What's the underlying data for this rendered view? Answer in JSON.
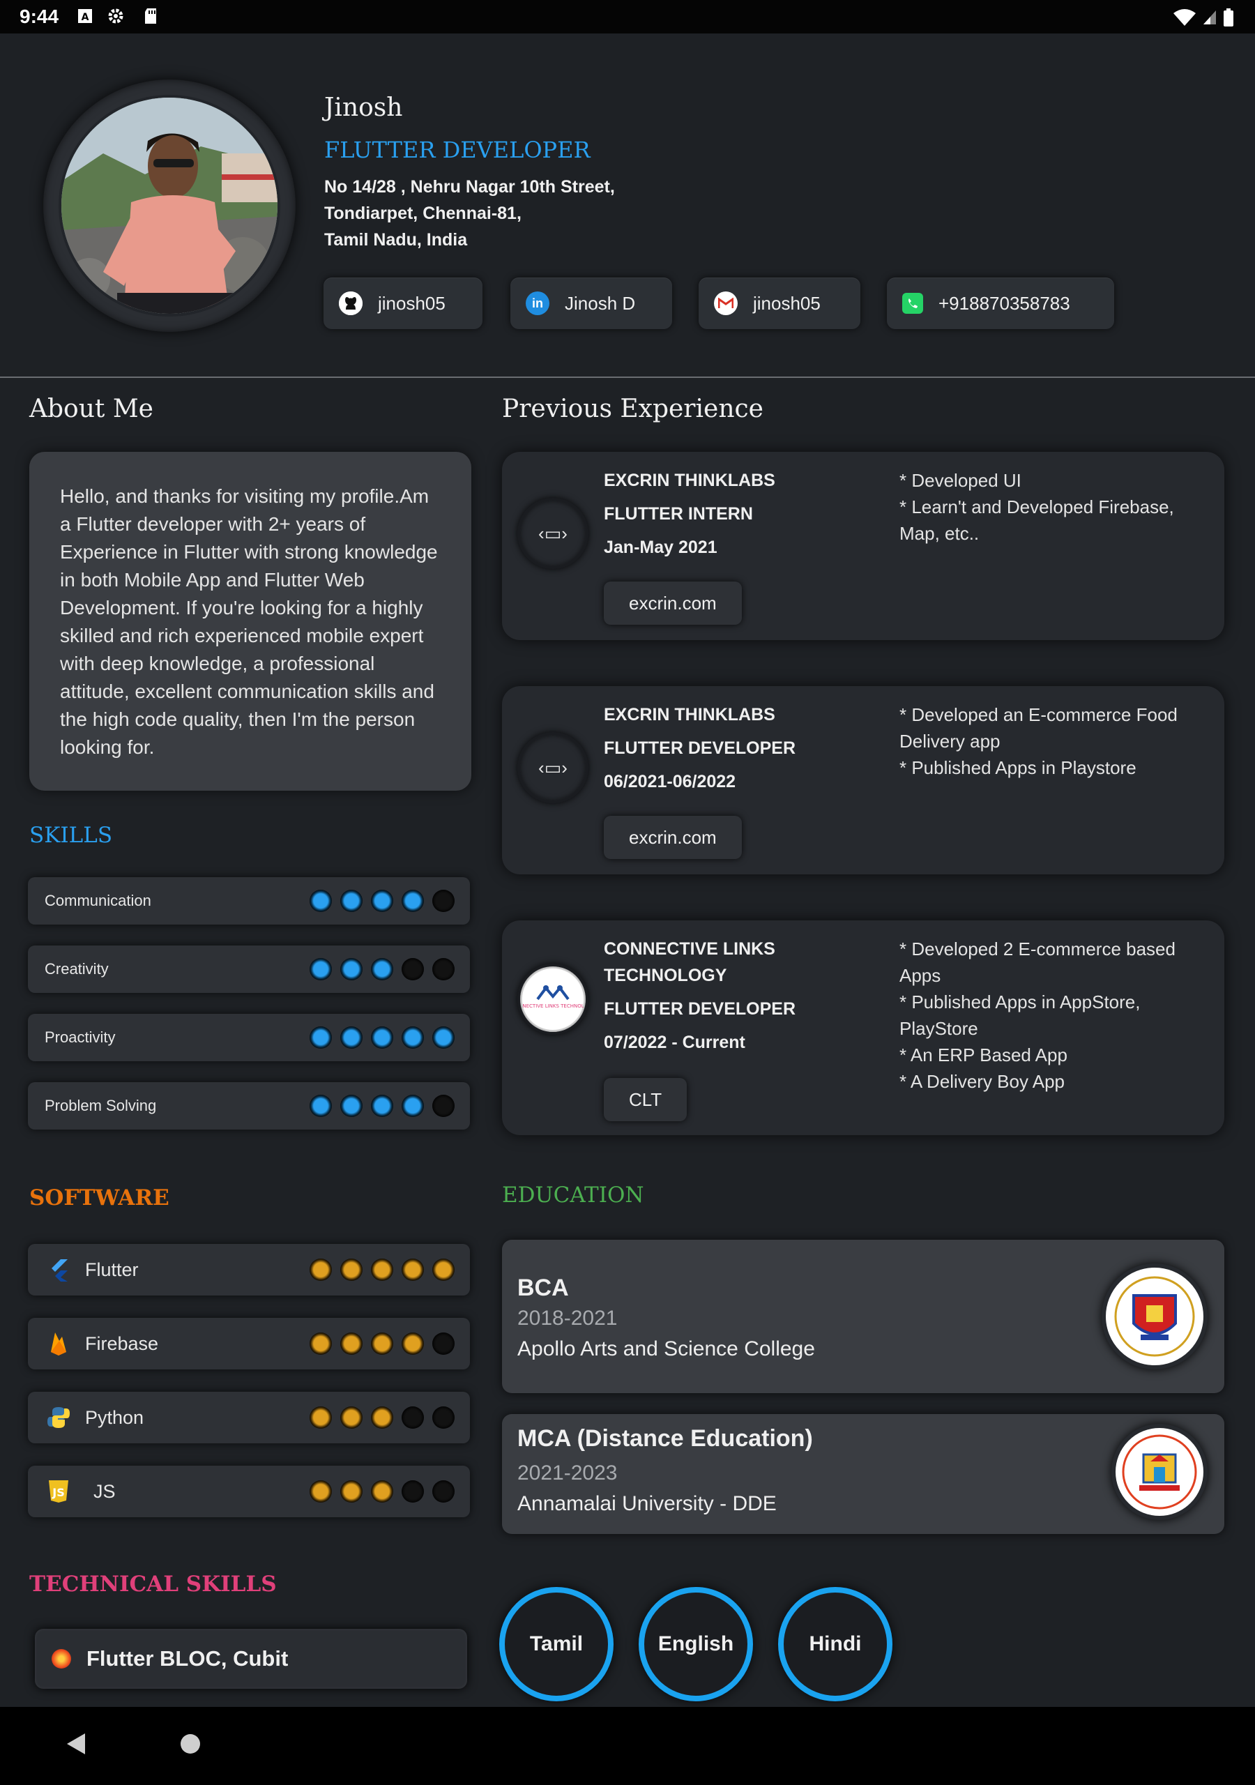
{
  "status_bar": {
    "time": "9:44",
    "icons": [
      "font-icon",
      "gear-icon",
      "sd-card-icon",
      "wifi-icon",
      "signal-icon",
      "battery-icon"
    ]
  },
  "profile": {
    "name": "Jinosh",
    "role": "FLUTTER DEVELOPER",
    "address": [
      "No 14/28 , Nehru Nagar 10th Street,",
      "Tondiarpet, Chennai-81,",
      "Tamil Nadu, India"
    ],
    "contacts": [
      {
        "icon": "github-icon",
        "label": "jinosh05"
      },
      {
        "icon": "linkedin-icon",
        "label": "Jinosh D"
      },
      {
        "icon": "gmail-icon",
        "label": "jinosh05"
      },
      {
        "icon": "whatsapp-icon",
        "label": "+918870358783"
      }
    ]
  },
  "about": {
    "title": "About Me",
    "text": "Hello, and thanks for visiting my profile.Am a Flutter developer with 2+ years of Experience in Flutter with strong knowledge in both Mobile App and Flutter Web Development. If you're looking for a highly skilled and rich experienced mobile expert with deep knowledge, a professional attitude, excellent communication skills and the high code quality, then I'm the person looking for."
  },
  "skills": {
    "title": "SKILLS",
    "items": [
      {
        "label": "Communication",
        "rating": 4,
        "max": 5
      },
      {
        "label": "Creativity",
        "rating": 3,
        "max": 5
      },
      {
        "label": "Proactivity",
        "rating": 5,
        "max": 5
      },
      {
        "label": "Problem Solving",
        "rating": 4,
        "max": 5
      }
    ]
  },
  "software": {
    "title": "SOFTWARE",
    "items": [
      {
        "label": "Flutter",
        "icon": "flutter-icon",
        "rating": 5,
        "max": 5
      },
      {
        "label": "Firebase",
        "icon": "firebase-icon",
        "rating": 4,
        "max": 5
      },
      {
        "label": "Python",
        "icon": "python-icon",
        "rating": 3,
        "max": 5
      },
      {
        "label": "JS",
        "icon": "js-icon",
        "rating": 3,
        "max": 5
      }
    ]
  },
  "technical_skills": {
    "title": "TECHNICAL SKILLS",
    "items": [
      "Flutter BLOC, Cubit"
    ]
  },
  "experience": {
    "title": "Previous Experience",
    "items": [
      {
        "company": "EXCRIN THINKLABS",
        "role": "FLUTTER INTERN",
        "period": "Jan-May 2021",
        "link": "excrin.com",
        "points": [
          "* Developed UI",
          "* Learn't and Developed Firebase, Map, etc.."
        ]
      },
      {
        "company": "EXCRIN THINKLABS",
        "role": "FLUTTER DEVELOPER",
        "period": "06/2021-06/2022",
        "link": "excrin.com",
        "points": [
          "* Developed an E-commerce Food Delivery app",
          "* Published Apps in Playstore"
        ]
      },
      {
        "company": "CONNECTIVE LINKS TECHNOLOGY",
        "role": "FLUTTER DEVELOPER",
        "period": "07/2022 - Current",
        "link": "CLT",
        "logo_text": "CONNECTIVE LINKS TECHNOLOGY",
        "points": [
          "* Developed 2 E-commerce based Apps",
          "* Published Apps in AppStore, PlayStore",
          "* An ERP Based App",
          "* A Delivery Boy App"
        ]
      }
    ]
  },
  "education": {
    "title": "EDUCATION",
    "items": [
      {
        "degree": "BCA",
        "years": "2018-2021",
        "school": "Apollo Arts and Science College"
      },
      {
        "degree": "MCA (Distance Education)",
        "years": "2021-2023",
        "school": "Annamalai University - DDE"
      }
    ]
  },
  "languages": [
    "Tamil",
    "English",
    "Hindi"
  ],
  "colors": {
    "accent_blue": "#2aa0f0",
    "software_orange": "#e8720c",
    "education_green": "#4caf50",
    "technical_pink": "#e0407a",
    "rating_gold": "#e0a020"
  }
}
